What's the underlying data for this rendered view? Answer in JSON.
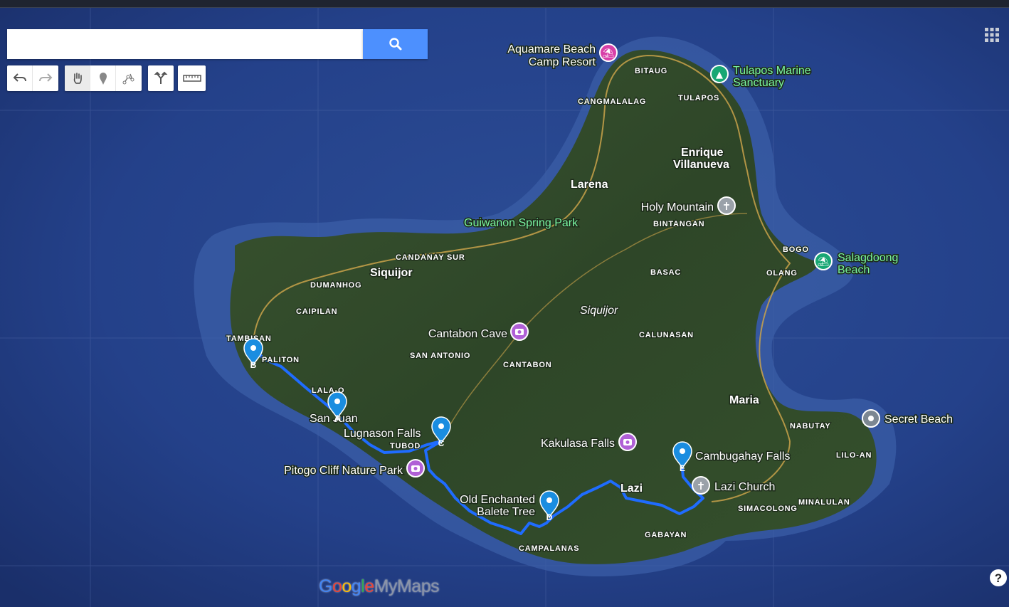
{
  "colors": {
    "route": "#1f6cff",
    "marker_blue": "#1a8de0",
    "poi_pink": "#d83fa8",
    "poi_purple": "#b060d6",
    "poi_green": "#18a774",
    "poi_gray": "#7c8792",
    "poi_label_green": "#7bf7a3",
    "church_gray": "#9aa1a9"
  },
  "search": {
    "placeholder": "",
    "value": "",
    "button_icon": "magnifier-icon"
  },
  "toolbar": {
    "undo_icon": "undo-icon",
    "redo_icon": "redo-icon",
    "pan_icon": "hand-icon",
    "marker_icon": "add-marker-icon",
    "line_icon": "draw-line-icon",
    "directions_icon": "directions-icon",
    "measure_icon": "ruler-icon"
  },
  "branding": {
    "logo_text": "GoogleMyMaps",
    "grid_icon": "apps-grid-icon",
    "help_icon": "help-icon"
  },
  "route_stops": [
    {
      "letter": "A",
      "label": "San Juan"
    },
    {
      "letter": "B",
      "label": ""
    },
    {
      "letter": "C",
      "label": "Lugnason Falls"
    },
    {
      "letter": "D",
      "label": "Old Enchanted Balete Tree"
    },
    {
      "letter": "E",
      "label": "Cambugahay Falls"
    }
  ],
  "pois": [
    {
      "name": "Aquamare Beach Camp Resort",
      "icon": "beach-umbrella-icon"
    },
    {
      "name": "Tulapos Marine Sanctuary",
      "icon": "tree-icon"
    },
    {
      "name": "Holy Mountain",
      "icon": "cross-icon"
    },
    {
      "name": "Salagdoong Beach",
      "icon": "beach-umbrella-icon"
    },
    {
      "name": "Cantabon Cave",
      "icon": "camera-icon"
    },
    {
      "name": "Kakulasa Falls",
      "icon": "camera-icon"
    },
    {
      "name": "Pitogo Cliff Nature Park",
      "icon": "camera-icon"
    },
    {
      "name": "Lazi Church",
      "icon": "cross-icon"
    },
    {
      "name": "Secret Beach",
      "icon": "pin-dot-icon"
    },
    {
      "name": "Guiwanon Spring Park",
      "icon": ""
    }
  ],
  "places": {
    "major": [
      "Siquijor",
      "Larena",
      "Enrique Villanueva",
      "Maria",
      "Lazi",
      "Siquijor"
    ],
    "minor": [
      "BITAUG",
      "CANGMALALAG",
      "TULAPOS",
      "BINTANGAN",
      "BOGO",
      "OLANG",
      "BASAC",
      "CANDANAY SUR",
      "DUMANHOG",
      "CAIPILAN",
      "TAMBISAN",
      "PALITON",
      "LALA-O",
      "TUBOD",
      "SAN ANTONIO",
      "CANTABON",
      "CALUNASAN",
      "NABUTAY",
      "LILO-AN",
      "SIMACOLONG",
      "MINALULAN",
      "GABAYAN",
      "CAMPALANAS"
    ]
  }
}
